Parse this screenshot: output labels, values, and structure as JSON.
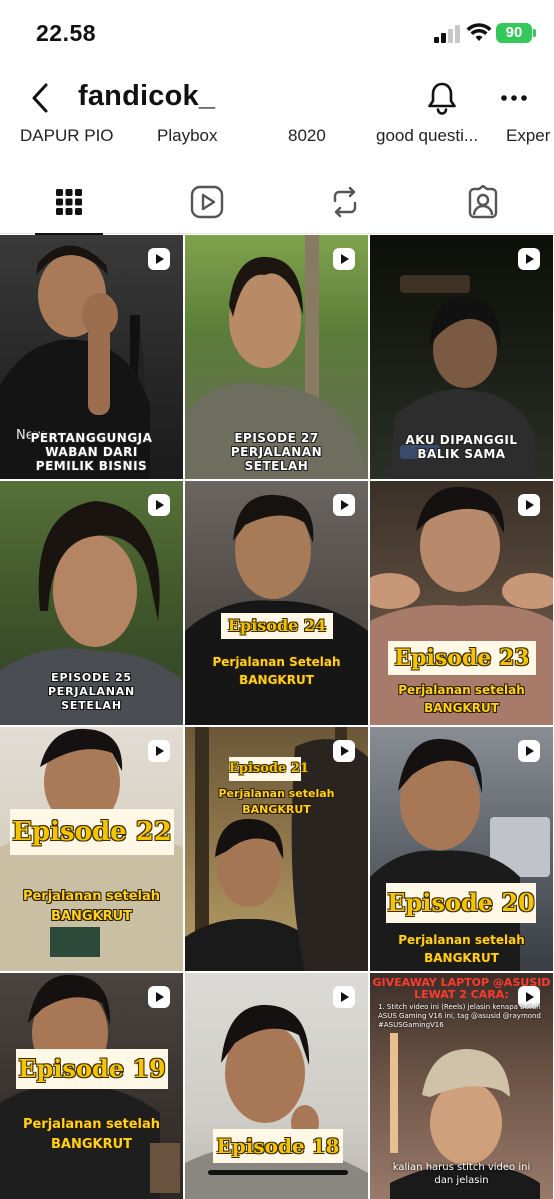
{
  "status_bar": {
    "time": "22.58",
    "battery": "90"
  },
  "header": {
    "username": "fandicok_"
  },
  "highlights": [
    {
      "label": "DAPUR PIO"
    },
    {
      "label": "Playbox"
    },
    {
      "label": "8020"
    },
    {
      "label": "good questi..."
    },
    {
      "label": "Exper"
    }
  ],
  "tabs": [
    {
      "name": "posts",
      "icon": "grid-icon",
      "active": true
    },
    {
      "name": "reels",
      "icon": "reels-icon",
      "active": false
    },
    {
      "name": "reposts",
      "icon": "repost-icon",
      "active": false
    },
    {
      "name": "tagged",
      "icon": "tagged-icon",
      "active": false
    }
  ],
  "posts": [
    {
      "caption_lines": [
        "PERTANGGUNGJA",
        "WABAN DARI",
        "PEMILIK BISNIS"
      ],
      "overlay": "New"
    },
    {
      "caption_lines": [
        "EPISODE 27",
        "PERJALANAN",
        "SETELAH"
      ]
    },
    {
      "caption_lines": [
        "AKU DIPANGGIL",
        "BALIK SAMA"
      ]
    },
    {
      "caption_lines": [
        "EPISODE 25",
        "PERJALANAN",
        "SETELAH"
      ]
    },
    {
      "episode": "Episode 24",
      "line1": "Perjalanan Setelah",
      "line2": "BANGKRUT"
    },
    {
      "episode": "Episode 23",
      "line1": "Perjalanan setelah",
      "line2": "BANGKRUT"
    },
    {
      "episode": "Episode 22",
      "line1": "Perjalanan setelah",
      "line2": "BANGKRUT"
    },
    {
      "episode": "Episode 21",
      "line1": "Perjalanan setelah",
      "line2": "BANGKRUT"
    },
    {
      "episode": "Episode 20",
      "line1": "Perjalanan setelah",
      "line2": "BANGKRUT"
    },
    {
      "episode": "Episode 19",
      "line1": "Perjalanan setelah",
      "line2": "BANGKRUT"
    },
    {
      "episode": "Episode 18"
    },
    {
      "giveaway_title_1": "GIVEAWAY LAPTOP @ASUSID",
      "giveaway_title_2": "LEWAT 2 CARA:",
      "giveaway_body": "1. Stitch video ini (Reels) jelasin kenapa butuh ASUS Gaming V16 ini, tag @asusid @raymond #ASUSGamingV16",
      "caption_1": "kalian harus stitch video ini",
      "caption_2": "dan jelasin"
    }
  ],
  "colors": {
    "accent_yellow": "#ffd21f",
    "battery_green": "#34c759",
    "giveaway_red": "#ff3b30"
  }
}
